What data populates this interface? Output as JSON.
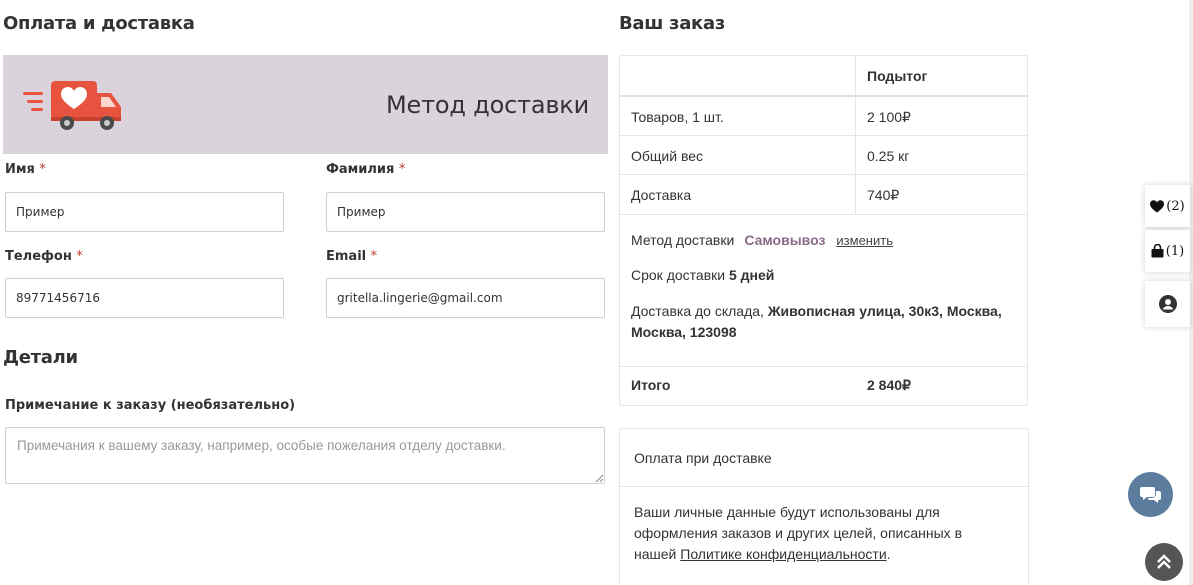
{
  "billing": {
    "title": "Оплата и доставка",
    "banner_title": "Метод доставки",
    "first_name": {
      "label": "Имя",
      "required_mark": "*",
      "value": "Пример"
    },
    "last_name": {
      "label": "Фамилия",
      "required_mark": "*",
      "value": "Пример"
    },
    "phone": {
      "label": "Телефон",
      "required_mark": "*",
      "value": "89771456716"
    },
    "email": {
      "label": "Email",
      "required_mark": "*",
      "value": "gritella.lingerie@gmail.com"
    }
  },
  "details": {
    "title": "Детали",
    "note_label": "Примечание к заказу (необязательно)",
    "note_placeholder": "Примечания к вашему заказу, например, особые пожелания отделу доставки."
  },
  "order": {
    "title": "Ваш заказ",
    "header_col": "Подытог",
    "rows": [
      {
        "label": "Товаров, 1 шт.",
        "value": "2 100₽"
      },
      {
        "label": "Общий вес",
        "value": "0.25 кг"
      },
      {
        "label": "Доставка",
        "value": "740₽"
      }
    ],
    "shipping": {
      "method_label": "Метод доставки",
      "method_value": "Самовывоз",
      "change_link": "изменить",
      "term_label": "Срок доставки",
      "term_value": "5 дней",
      "address_label": "Доставка до склада,",
      "address_value": "Живописная улица, 30к3, Москва, Москва, 123098"
    },
    "total_label": "Итого",
    "total_value": "2 840₽"
  },
  "payment": {
    "method": "Оплата при доставке",
    "privacy_text": "Ваши личные данные будут использованы для оформления заказов и других целей, описанных в нашей",
    "privacy_link": "Политике конфиденциальности",
    "privacy_end": "."
  },
  "widgets": {
    "wishlist_count": "(2)",
    "cart_count": "(1)"
  },
  "colors": {
    "banner_bg": "#dbd3dc",
    "accent_method": "#8a6b86",
    "required": "#c0392b",
    "chat_bg": "#5c7d9e",
    "truck_red": "#e8533f"
  }
}
